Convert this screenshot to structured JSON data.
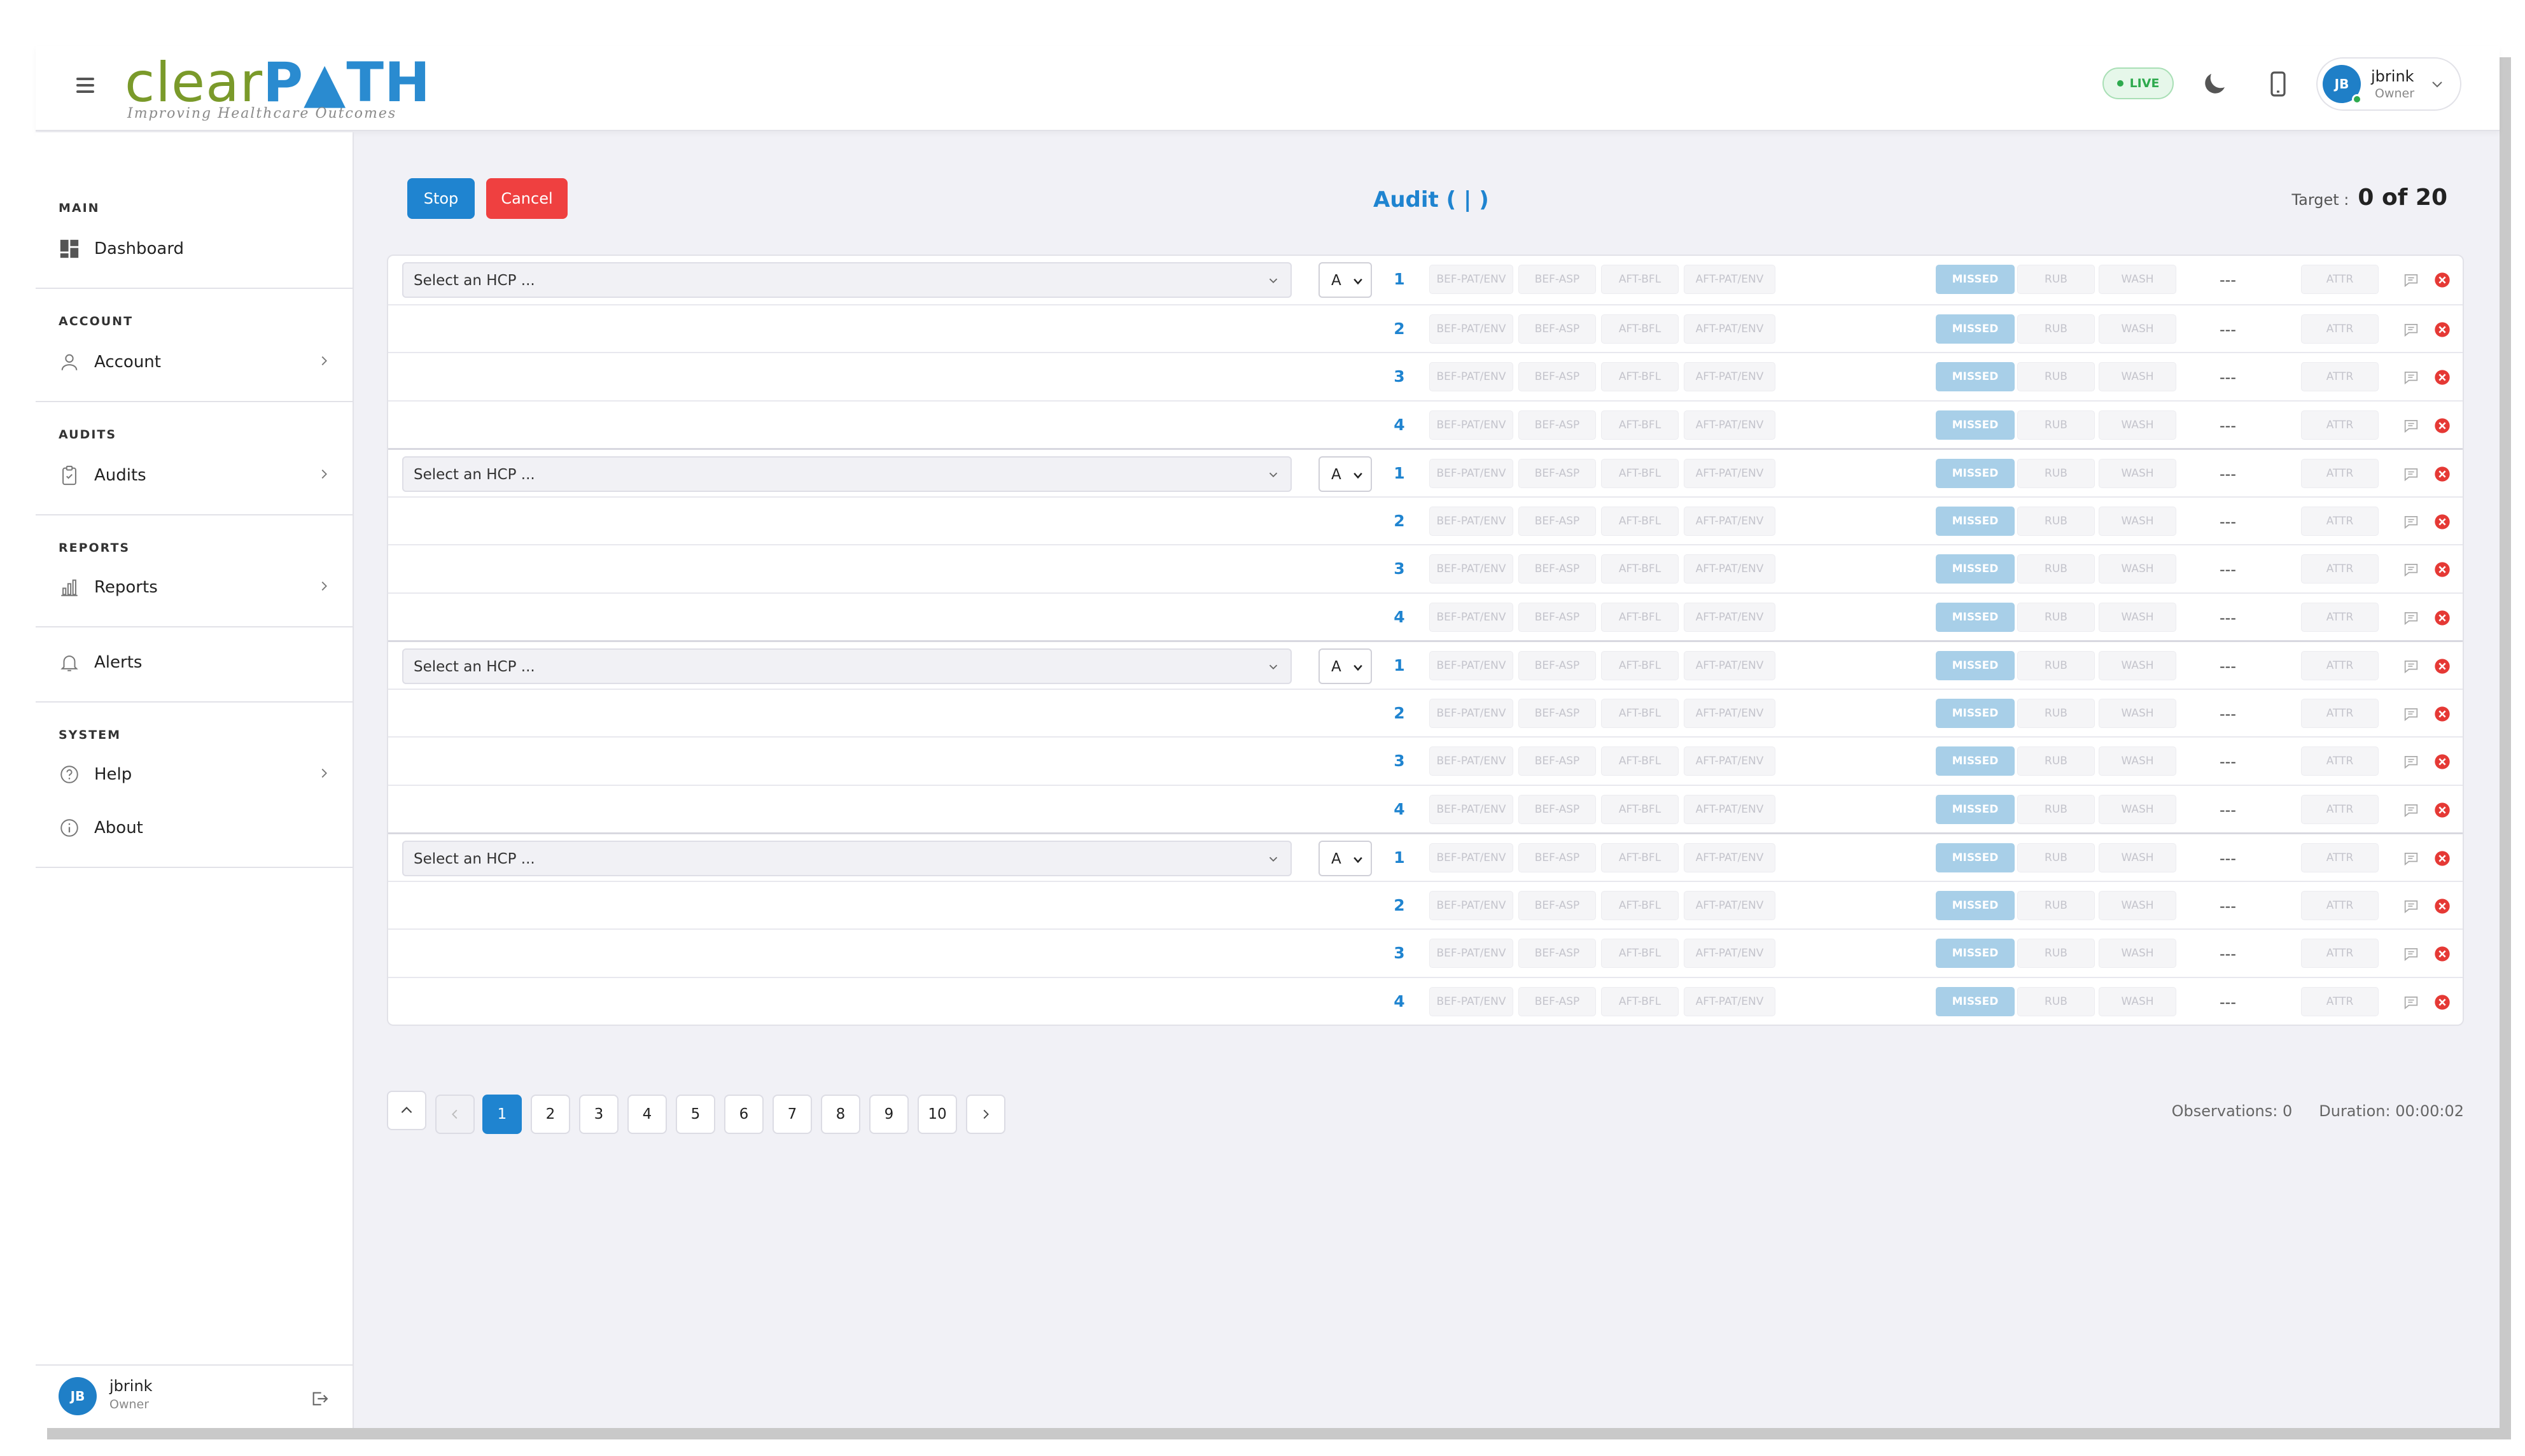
{
  "header": {
    "logo_clear": "clear",
    "logo_path": "P▲TH",
    "logo_tagline": "Improving Healthcare Outcomes",
    "live_label": "LIVE",
    "user": {
      "initials": "JB",
      "name": "jbrink",
      "role": "Owner"
    }
  },
  "sidebar": {
    "sections": {
      "main": "MAIN",
      "account": "ACCOUNT",
      "audits": "AUDITS",
      "reports": "REPORTS",
      "system": "SYSTEM"
    },
    "items": {
      "dashboard": "Dashboard",
      "account": "Account",
      "audits": "Audits",
      "reports": "Reports",
      "alerts": "Alerts",
      "help": "Help",
      "about": "About"
    },
    "user": {
      "initials": "JB",
      "name": "jbrink",
      "role": "Owner"
    }
  },
  "toolbar": {
    "stop_label": "Stop",
    "cancel_label": "Cancel",
    "audit_title": "Audit ( | )",
    "target_label": "Target :",
    "target_value": "0 of 20"
  },
  "grid": {
    "hcp_placeholder": "Select an HCP ...",
    "letter_value": "A",
    "moments": [
      "BEF-PAT/ENV",
      "BEF-ASP",
      "AFT-BFL",
      "AFT-PAT/ENV"
    ],
    "actions": [
      "MISSED",
      "RUB",
      "WASH"
    ],
    "empty_value": "---",
    "attr_label": "ATTR",
    "groups": [
      {
        "rows": [
          "1",
          "2",
          "3",
          "4"
        ]
      },
      {
        "rows": [
          "1",
          "2",
          "3",
          "4"
        ]
      },
      {
        "rows": [
          "1",
          "2",
          "3",
          "4"
        ]
      },
      {
        "rows": [
          "1",
          "2",
          "3",
          "4"
        ]
      }
    ]
  },
  "pagination": {
    "pages": [
      "1",
      "2",
      "3",
      "4",
      "5",
      "6",
      "7",
      "8",
      "9",
      "10"
    ],
    "current": "1"
  },
  "stats": {
    "observations": "Observations: 0",
    "duration": "Duration: 00:00:02"
  },
  "colors": {
    "accent": "#1f84d0",
    "danger": "#ef4040",
    "live": "#2eaa4e",
    "missed_chip": "#a8cfe8"
  }
}
